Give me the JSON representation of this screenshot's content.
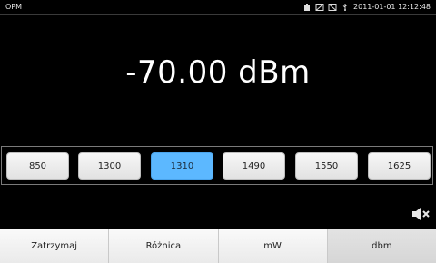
{
  "status_bar": {
    "app_name": "OPM",
    "datetime": "2011-01-01 12:12:48",
    "icons": [
      "battery-icon",
      "sd-card-icon",
      "no-signal-icon",
      "usb-icon"
    ]
  },
  "reading": {
    "value": "-70.00 dBm"
  },
  "wavelengths": {
    "buttons": [
      "850",
      "1300",
      "1310",
      "1490",
      "1550",
      "1625"
    ],
    "selected": "1310",
    "accent_color": "#5cb8ff"
  },
  "speaker": {
    "icon": "speaker-muted-icon"
  },
  "bottom_bar": {
    "buttons": [
      "Zatrzymaj",
      "Różnica",
      "mW",
      "dbm"
    ],
    "selected": "dbm"
  }
}
